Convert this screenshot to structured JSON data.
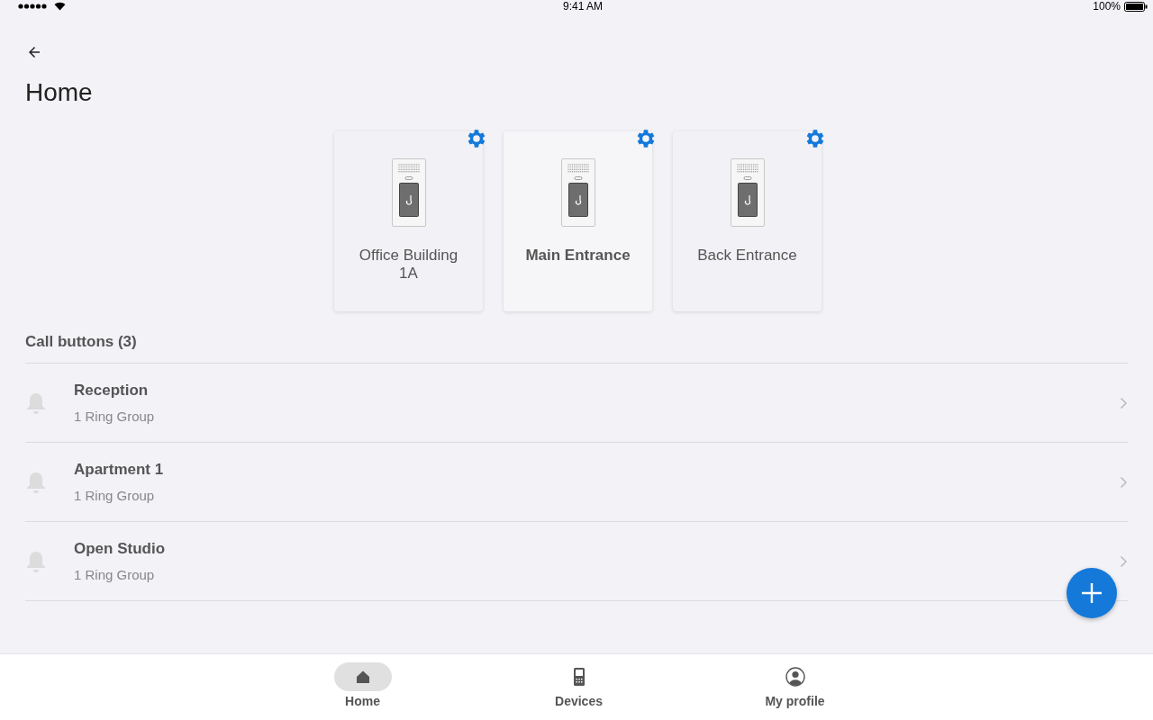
{
  "status_bar": {
    "time": "9:41 AM",
    "battery": "100%"
  },
  "page": {
    "title": "Home"
  },
  "devices": [
    {
      "name": "Office Building 1A",
      "selected": false
    },
    {
      "name": "Main Entrance",
      "selected": true
    },
    {
      "name": "Back Entrance",
      "selected": false
    }
  ],
  "section": {
    "title": "Call buttons (3)"
  },
  "call_buttons": [
    {
      "name": "Reception",
      "subtitle": "1 Ring Group"
    },
    {
      "name": "Apartment 1",
      "subtitle": "1 Ring Group"
    },
    {
      "name": "Open Studio",
      "subtitle": "1 Ring Group"
    }
  ],
  "bottom_nav": [
    {
      "label": "Home",
      "kind": "home",
      "selected": true
    },
    {
      "label": "Devices",
      "kind": "devices",
      "selected": false
    },
    {
      "label": "My profile",
      "kind": "profile",
      "selected": false
    }
  ]
}
